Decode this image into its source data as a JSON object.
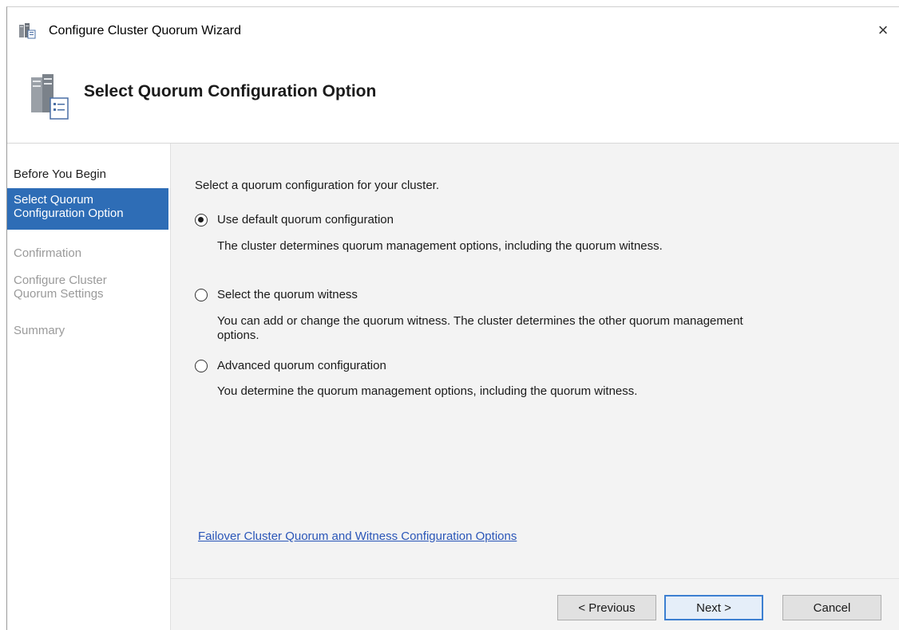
{
  "window": {
    "title": "Configure Cluster Quorum Wizard",
    "close_symbol": "×",
    "header_title": "Select Quorum Configuration Option"
  },
  "sidebar": {
    "items": [
      {
        "label_lines": [
          "Before You Begin"
        ],
        "state": "done"
      },
      {
        "label_lines": [
          "Select Quorum",
          "Configuration Option"
        ],
        "state": "active"
      },
      {
        "label_lines": [
          "Confirmation"
        ],
        "state": "pending"
      },
      {
        "label_lines": [
          "Configure Cluster",
          "Quorum Settings"
        ],
        "state": "pending"
      },
      {
        "label_lines": [
          "Summary"
        ],
        "state": "pending"
      }
    ]
  },
  "main": {
    "intro": "Select a quorum configuration for your cluster.",
    "options": [
      {
        "label": "Use default quorum configuration",
        "checked": true,
        "desc_lines": [
          "The cluster determines quorum management options, including the quorum witness."
        ]
      },
      {
        "label": "Select the quorum witness",
        "checked": false,
        "desc_lines": [
          "You can add or change the quorum witness. The cluster determines the other quorum management",
          "options."
        ]
      },
      {
        "label": "Advanced quorum configuration",
        "checked": false,
        "desc_lines": [
          "You determine the quorum management options, including the quorum witness."
        ]
      }
    ],
    "help_link": "Failover Cluster Quorum and Witness Configuration Options"
  },
  "buttons": {
    "previous": "< Previous",
    "next": "Next >",
    "cancel": "Cancel"
  },
  "colors": {
    "active_nav_bg": "#2e6db6",
    "link": "#2a56b8",
    "content_bg": "#f3f3f3"
  }
}
